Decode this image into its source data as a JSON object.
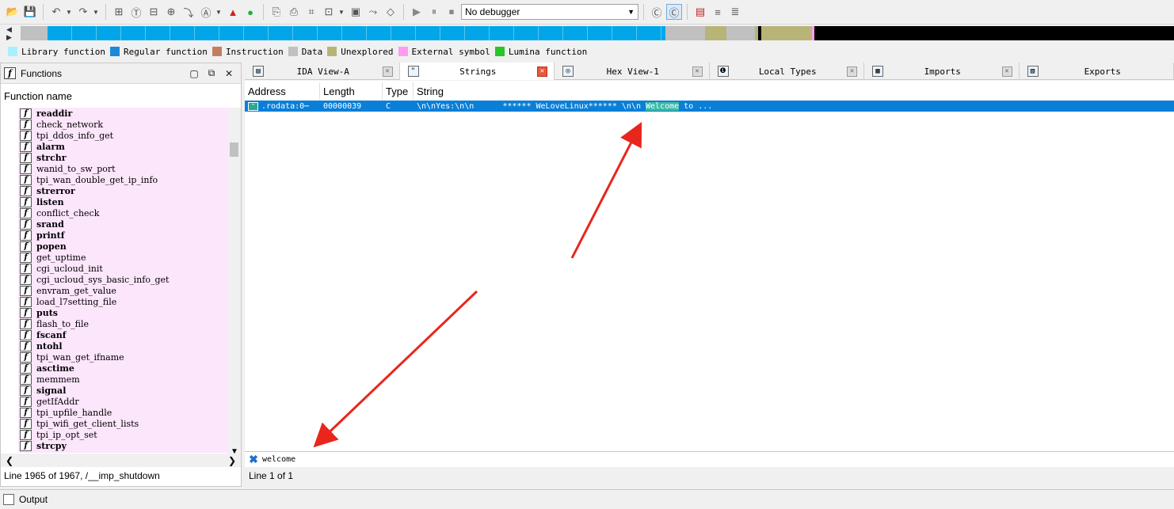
{
  "toolbar": {
    "debugger": "No debugger"
  },
  "nav_colors": {
    "library": "#a8f0ff",
    "regular": "#00a6e8",
    "instruction": "#c08060",
    "data": "#c0c0c0",
    "unexplored": "#b8b478",
    "external": "#ff9cf0",
    "lumina": "#28c428",
    "black": "#000000"
  },
  "legend": [
    {
      "label": "Library function",
      "color": "#a8f0ff"
    },
    {
      "label": "Regular function",
      "color": "#1a8ad8"
    },
    {
      "label": "Instruction",
      "color": "#c08060"
    },
    {
      "label": "Data",
      "color": "#c0c0c0"
    },
    {
      "label": "Unexplored",
      "color": "#b8b478"
    },
    {
      "label": "External symbol",
      "color": "#ff9cf0"
    },
    {
      "label": "Lumina function",
      "color": "#28c428"
    }
  ],
  "functions_panel": {
    "title": "Functions",
    "column_header": "Function name",
    "status": "Line 1965 of 1967, /__imp_shutdown",
    "items": [
      {
        "name": "readdir",
        "bold": true
      },
      {
        "name": "check_network",
        "bold": false
      },
      {
        "name": "tpi_ddos_info_get",
        "bold": false
      },
      {
        "name": "alarm",
        "bold": true
      },
      {
        "name": "strchr",
        "bold": true
      },
      {
        "name": "wanid_to_sw_port",
        "bold": false
      },
      {
        "name": "tpi_wan_double_get_ip_info",
        "bold": false
      },
      {
        "name": "strerror",
        "bold": true
      },
      {
        "name": "listen",
        "bold": true
      },
      {
        "name": "conflict_check",
        "bold": false
      },
      {
        "name": "srand",
        "bold": true
      },
      {
        "name": "printf",
        "bold": true
      },
      {
        "name": "popen",
        "bold": true
      },
      {
        "name": "get_uptime",
        "bold": false
      },
      {
        "name": "cgi_ucloud_init",
        "bold": false
      },
      {
        "name": "cgi_ucloud_sys_basic_info_get",
        "bold": false
      },
      {
        "name": "envram_get_value",
        "bold": false
      },
      {
        "name": "load_l7setting_file",
        "bold": false
      },
      {
        "name": "puts",
        "bold": true
      },
      {
        "name": "flash_to_file",
        "bold": false
      },
      {
        "name": "fscanf",
        "bold": true
      },
      {
        "name": "ntohl",
        "bold": true
      },
      {
        "name": "tpi_wan_get_ifname",
        "bold": false
      },
      {
        "name": "asctime",
        "bold": true
      },
      {
        "name": "memmem",
        "bold": false
      },
      {
        "name": "signal",
        "bold": true
      },
      {
        "name": "getIfAddr",
        "bold": false
      },
      {
        "name": "tpi_upfile_handle",
        "bold": false
      },
      {
        "name": "tpi_wifi_get_client_lists",
        "bold": false
      },
      {
        "name": "tpi_ip_opt_set",
        "bold": false
      },
      {
        "name": "strcpy",
        "bold": true
      }
    ]
  },
  "tabs": [
    {
      "label": "IDA View-A",
      "active": false
    },
    {
      "label": "Strings",
      "active": true
    },
    {
      "label": "Hex View-1",
      "active": false
    },
    {
      "label": "Local Types",
      "active": false
    },
    {
      "label": "Imports",
      "active": false
    },
    {
      "label": "Exports",
      "active": false
    }
  ],
  "strings_view": {
    "columns": [
      "Address",
      "Length",
      "Type",
      "String"
    ],
    "row": {
      "address": ".rodata:0⋯",
      "length": "00000039",
      "type": "C",
      "string_pre": "\\n\\nYes:\\n\\n      ****** WeLoveLinux****** \\n\\n ",
      "string_match": "Welcome",
      "string_post": " to ..."
    },
    "search_value": "welcome",
    "status": "Line 1 of 1"
  },
  "output": {
    "label": "Output"
  }
}
